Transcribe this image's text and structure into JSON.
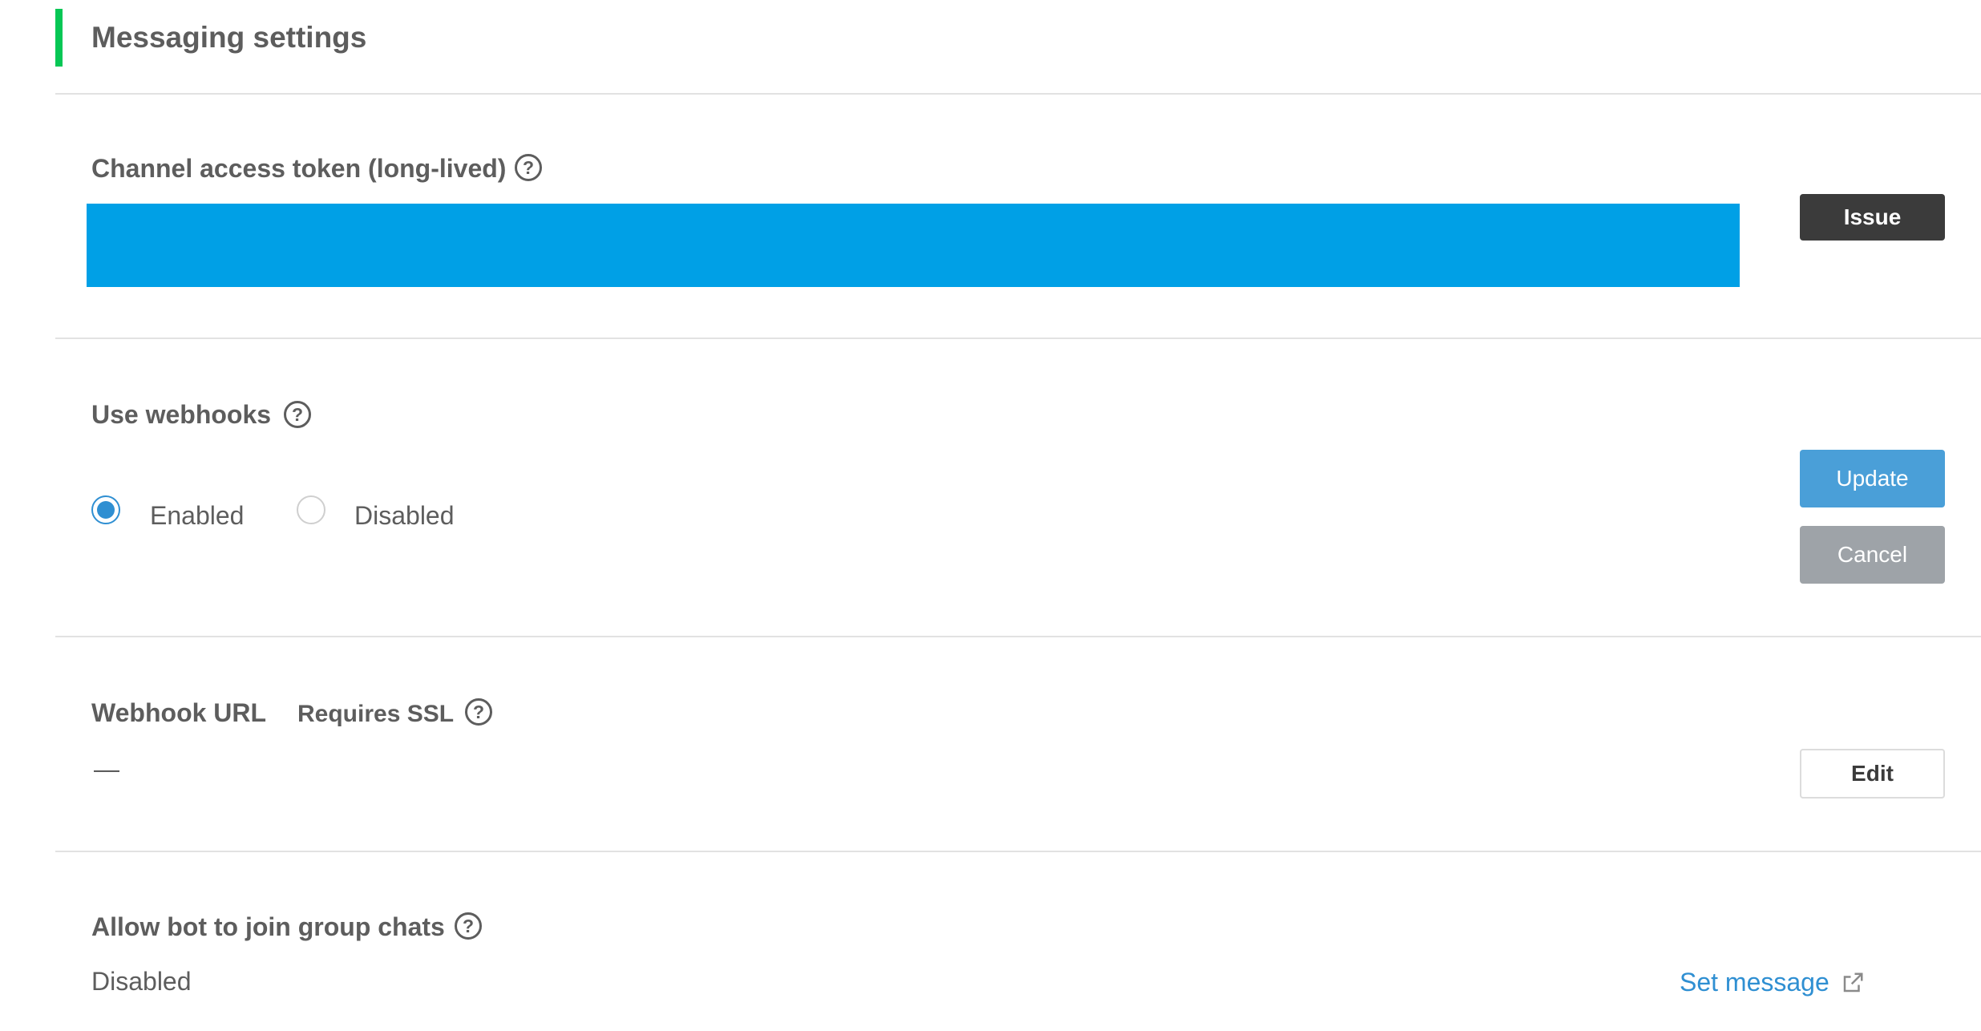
{
  "header": {
    "title": "Messaging settings",
    "accent_color": "#06c755"
  },
  "channel_token": {
    "label": "Channel access token (long-lived)",
    "help_icon": "question-circle-icon",
    "token_mask_color": "#00a0e6",
    "issue_label": "Issue"
  },
  "webhooks": {
    "label": "Use webhooks",
    "help_icon": "question-circle-icon",
    "options": [
      {
        "label": "Enabled",
        "selected": true
      },
      {
        "label": "Disabled",
        "selected": false
      }
    ],
    "update_label": "Update",
    "cancel_label": "Cancel"
  },
  "webhook_url": {
    "label": "Webhook URL",
    "note": "Requires SSL",
    "help_icon": "question-circle-icon",
    "value": "—",
    "edit_label": "Edit"
  },
  "group_chats": {
    "label": "Allow bot to join group chats",
    "help_icon": "question-circle-icon",
    "value": "Disabled",
    "link_label": "Set message",
    "link_icon": "external-link-icon"
  },
  "help_glyph": "?"
}
